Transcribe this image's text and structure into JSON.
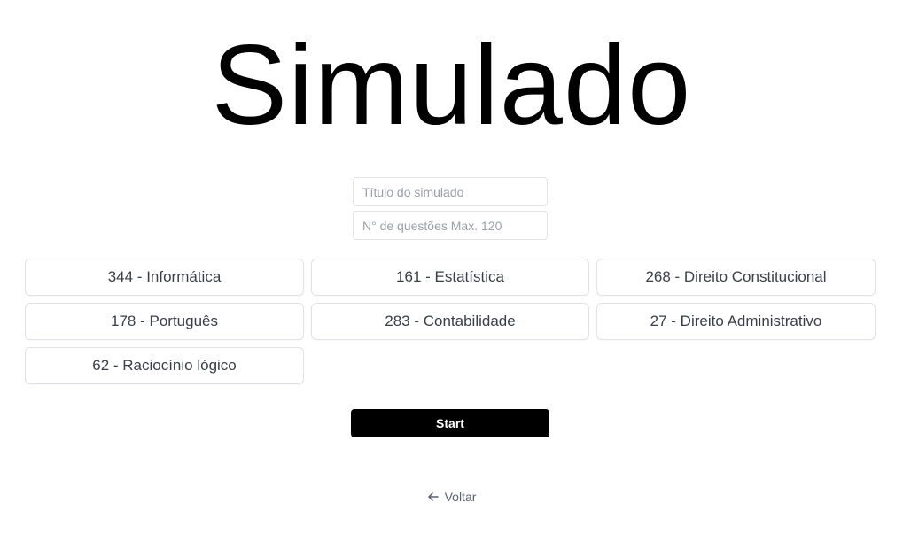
{
  "page": {
    "title": "Simulado"
  },
  "form": {
    "title_placeholder": "Título do simulado",
    "count_placeholder": "N° de questões Max. 120"
  },
  "subjects": [
    {
      "label": "344 - Informática"
    },
    {
      "label": "161 - Estatística"
    },
    {
      "label": "268 - Direito Constitucional"
    },
    {
      "label": "178 - Português"
    },
    {
      "label": "283 - Contabilidade"
    },
    {
      "label": "27 - Direito Administrativo"
    },
    {
      "label": "62 - Raciocínio lógico"
    }
  ],
  "actions": {
    "start_label": "Start",
    "back_label": "Voltar",
    "back_icon": "arrow-left-icon"
  },
  "colors": {
    "primary_button": "#000000",
    "button_text": "#ffffff",
    "muted_text": "#5c6370"
  }
}
